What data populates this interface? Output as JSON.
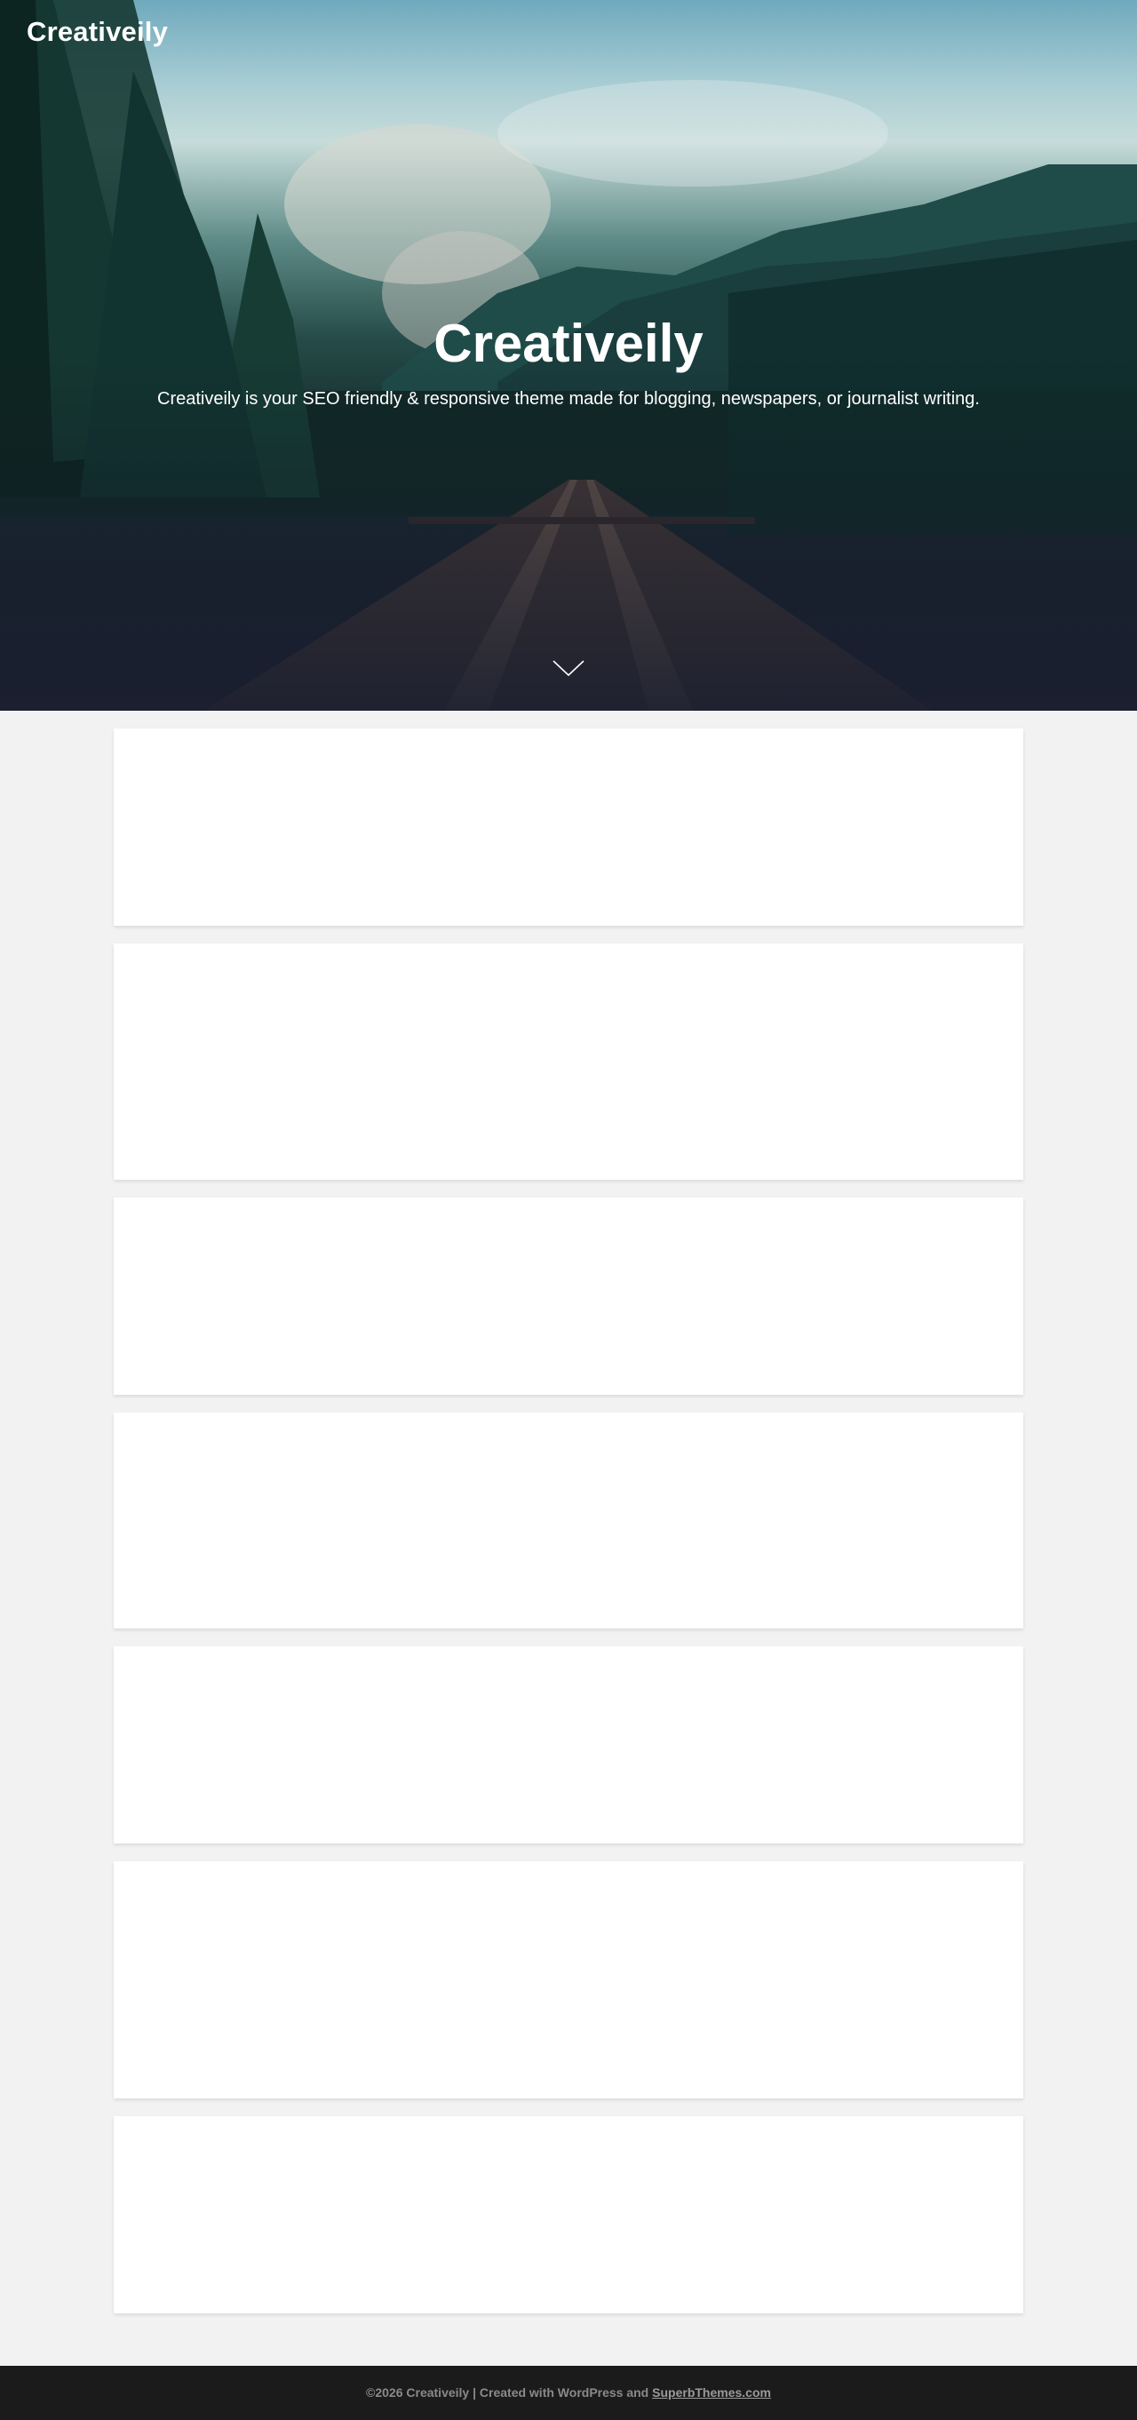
{
  "header": {
    "site_logo": "Creativeily"
  },
  "hero": {
    "title": "Creativeily",
    "tagline": "Creativeily is your SEO friendly & responsive theme made for blogging, newspapers, or journalist writing.",
    "scroll_icon": "chevron-down-icon"
  },
  "posts": {
    "count": 7
  },
  "footer": {
    "copyright": "©2026 Creativeily | Created with WordPress and",
    "link_text": "SuperbThemes.com"
  },
  "colors": {
    "page_background": "#f2f2f2",
    "card_background": "#ffffff",
    "footer_background": "#1b1b1b",
    "footer_text": "#8a8a8a",
    "hero_text": "#ffffff"
  }
}
